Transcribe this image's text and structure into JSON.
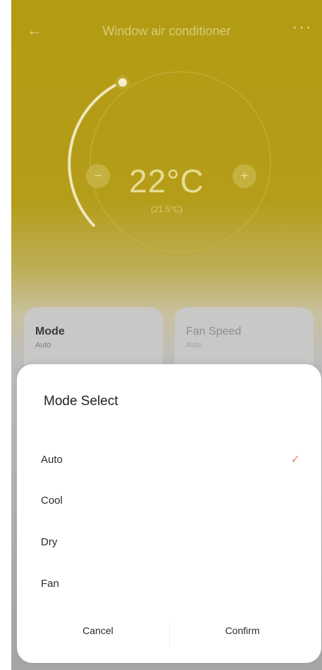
{
  "header": {
    "title": "Window air conditioner",
    "back_icon": "arrow-left-icon",
    "more_icon": "more-dots-icon"
  },
  "dial": {
    "temperature": "22°C",
    "subtitle": "(21.5°C)",
    "decrease_icon": "minus-icon",
    "increase_icon": "plus-icon"
  },
  "cards": {
    "mode": {
      "label": "Mode",
      "value": "Auto"
    },
    "fan": {
      "label": "Fan Speed",
      "value": "Auto"
    }
  },
  "dialog": {
    "title": "Mode Select",
    "options": [
      {
        "label": "Auto",
        "selected": true
      },
      {
        "label": "Cool",
        "selected": false
      },
      {
        "label": "Dry",
        "selected": false
      },
      {
        "label": "Fan",
        "selected": false
      }
    ],
    "check_icon": "check-icon",
    "cancel_label": "Cancel",
    "confirm_label": "Confirm"
  },
  "colors": {
    "accent": "#e08a6a",
    "header_bg": "#b39b12"
  }
}
